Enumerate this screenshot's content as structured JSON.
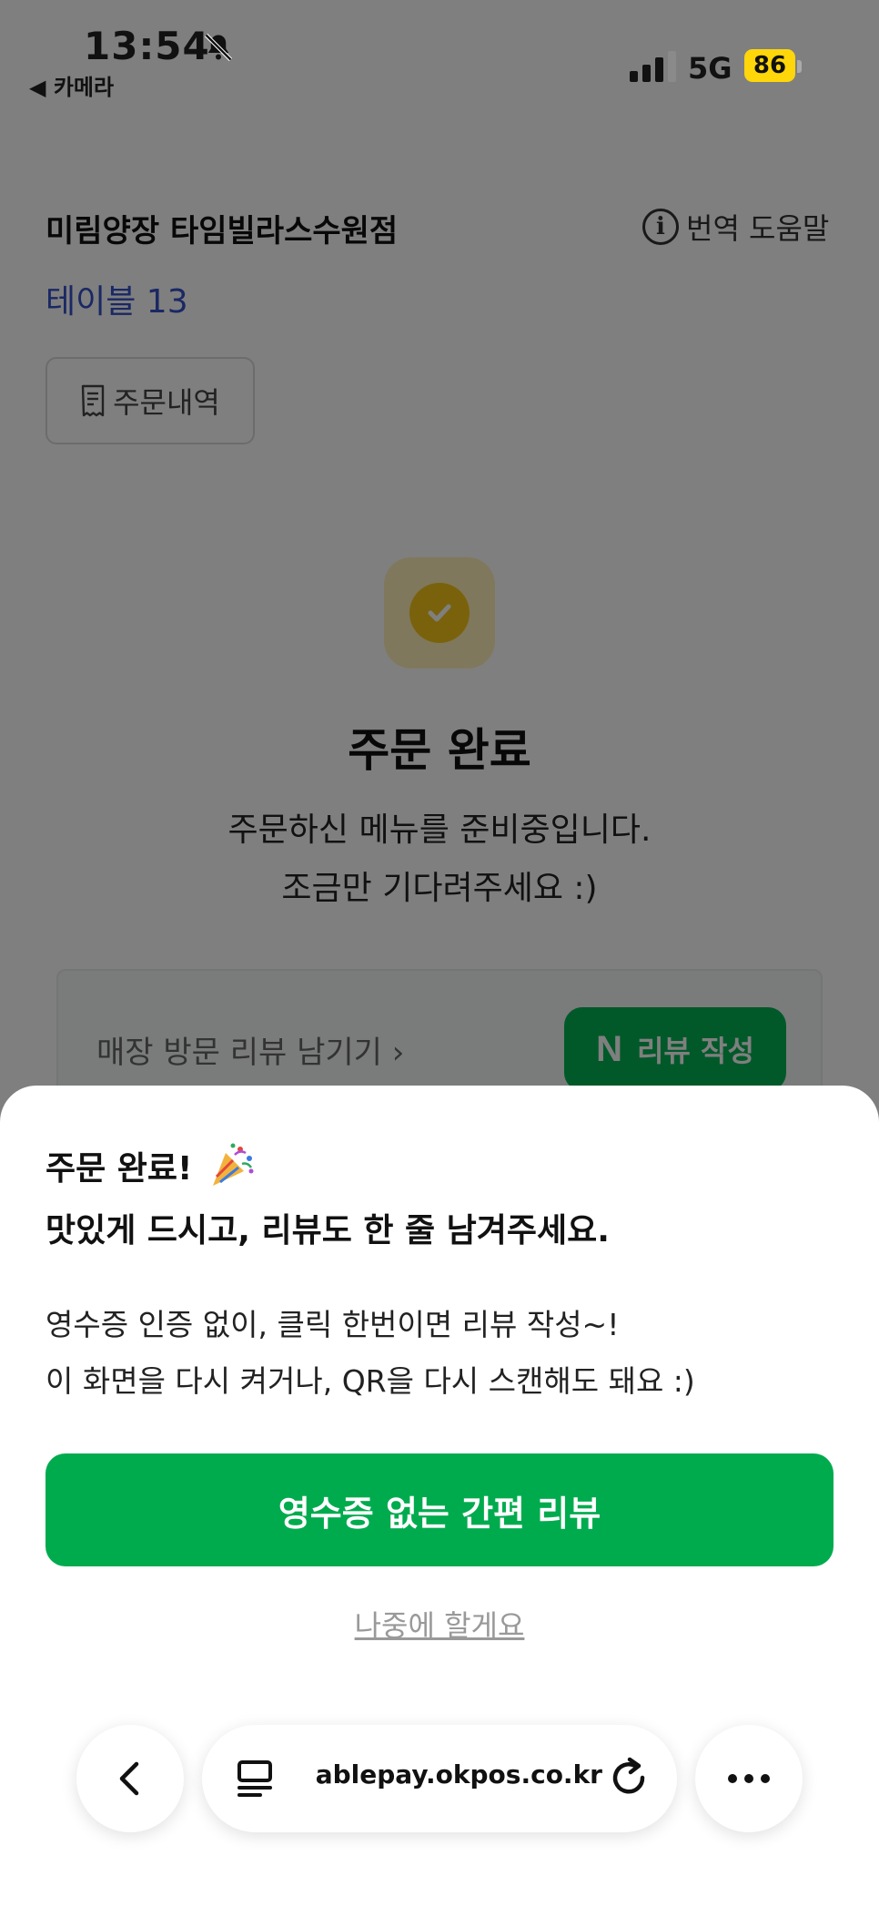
{
  "status_bar": {
    "time": "13:54",
    "back_app": "◀ 카메라",
    "network": "5G",
    "battery": "86",
    "battery_color": "#ffd60a"
  },
  "header": {
    "store_name": "미림양장 타임빌라스수원점",
    "help_label": "번역 도움말",
    "table_label": "테이블 13"
  },
  "order_history_button": {
    "label": "주문내역"
  },
  "completion": {
    "title": "주문 완료",
    "desc_line1": "주문하신 메뉴를 준비중입니다.",
    "desc_line2": "조금만 기다려주세요 :)"
  },
  "review_card": {
    "text": "매장 방문 리뷰 남기기 ›",
    "button_logo": "N",
    "button_label": "리뷰 작성",
    "button_color": "#03b353"
  },
  "sheet": {
    "title_line1": "주문 완료!",
    "title_line2": "맛있게 드시고, 리뷰도 한 줄 남겨주세요.",
    "desc_line1": "영수증 인증 없이, 클릭 한번이면 리뷰 작성~!",
    "desc_line2": "이 화면을 다시 켜거나, QR을  다시 스캔해도 돼요 :)",
    "primary_button": "영수증 없는 간편 리뷰",
    "primary_color": "#00ab4e",
    "later_link": "나중에 할게요"
  },
  "browser": {
    "url": "ablepay.okpos.co.kr"
  },
  "colors": {
    "table_label": "#3550c8",
    "check_icon": "#f4c518"
  }
}
